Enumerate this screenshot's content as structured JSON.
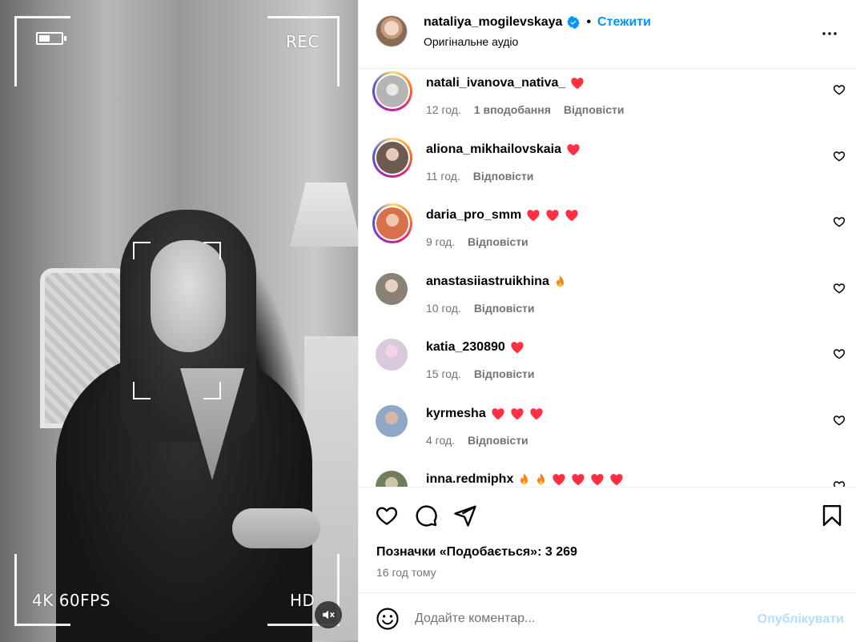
{
  "media": {
    "hud": {
      "rec": "REC",
      "fps": "4K 60FPS",
      "hd": "HD",
      "battery_level": 0.5
    },
    "mute_icon": "speaker-muted-icon"
  },
  "header": {
    "username": "nataliya_mogilevskaya",
    "dot": "•",
    "follow_label": "Стежити",
    "audio": "Оригінальне аудіо",
    "verified_icon": "verified-badge-icon",
    "more_icon": "more-options-icon"
  },
  "comments": [
    {
      "username": "natali_ivanova_nativa_",
      "emojis": [
        "heart"
      ],
      "time": "12 год.",
      "likes": "1 вподобання",
      "reply": "Відповісти",
      "story_ring": true
    },
    {
      "username": "aliona_mikhailovskaia",
      "emojis": [
        "heart"
      ],
      "time": "11 год.",
      "likes": "",
      "reply": "Відповісти",
      "story_ring": true
    },
    {
      "username": "daria_pro_smm",
      "emojis": [
        "heart",
        "heart",
        "heart"
      ],
      "time": "9 год.",
      "likes": "",
      "reply": "Відповісти",
      "story_ring": true
    },
    {
      "username": "anastasiiastruikhina",
      "emojis": [
        "fire"
      ],
      "time": "10 год.",
      "likes": "",
      "reply": "Відповісти",
      "story_ring": false
    },
    {
      "username": "katia_230890",
      "emojis": [
        "heart"
      ],
      "time": "15 год.",
      "likes": "",
      "reply": "Відповісти",
      "story_ring": false
    },
    {
      "username": "kyrmesha",
      "emojis": [
        "heart",
        "heart",
        "heart"
      ],
      "time": "4 год.",
      "likes": "",
      "reply": "Відповісти",
      "story_ring": false
    },
    {
      "username": "inna.redmiphx",
      "emojis": [
        "fire",
        "fire",
        "heart",
        "heart",
        "heart",
        "heart"
      ],
      "time": "",
      "likes": "",
      "reply": "",
      "story_ring": false
    }
  ],
  "actions": {
    "icons": [
      "like-icon",
      "comment-icon",
      "share-icon",
      "save-icon"
    ],
    "likes_text": "Позначки «Подобається»: 3 269",
    "posted_ago": "16 год тому"
  },
  "add_comment": {
    "placeholder": "Додайте коментар...",
    "publish_label": "Опублікувати",
    "emoji_icon": "emoji-smile-icon"
  },
  "colors": {
    "link_blue": "#0095f6",
    "publish_disabled": "#b2dffc",
    "heart_red": "#ff3040",
    "muted_text": "#737373"
  }
}
